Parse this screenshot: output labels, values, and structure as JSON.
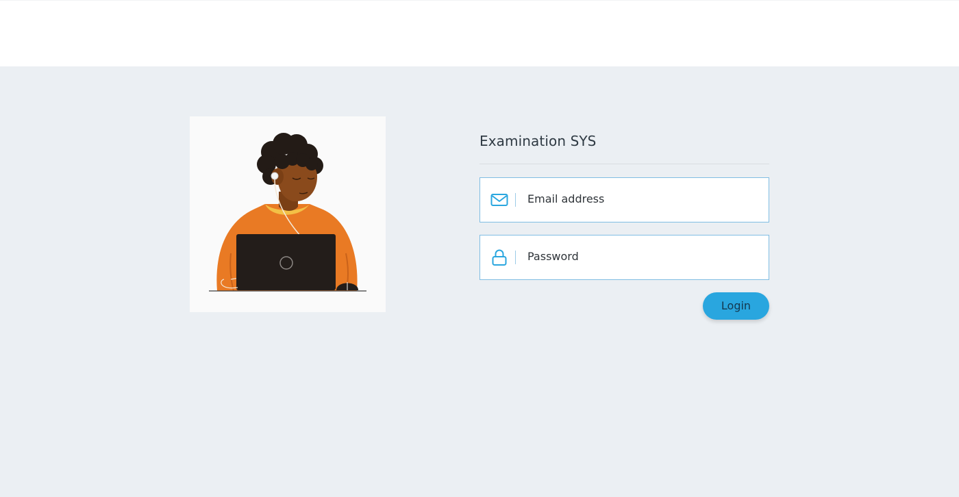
{
  "app": {
    "title": "Examination SYS"
  },
  "login_form": {
    "email": {
      "placeholder": "Email address",
      "icon": "envelope-icon"
    },
    "password": {
      "placeholder": "Password",
      "icon": "lock-icon"
    },
    "login_label": "Login"
  },
  "illustration": {
    "subject": "person-with-laptop-illustration"
  },
  "colors": {
    "page_background": "#ebeff3",
    "header_background": "#ffffff",
    "accent": "#29a6df",
    "field_border": "#7fbde3",
    "sweater": "#e97a24",
    "skin": "#8a4a1c",
    "hair": "#231b16",
    "laptop": "#231d1a"
  }
}
